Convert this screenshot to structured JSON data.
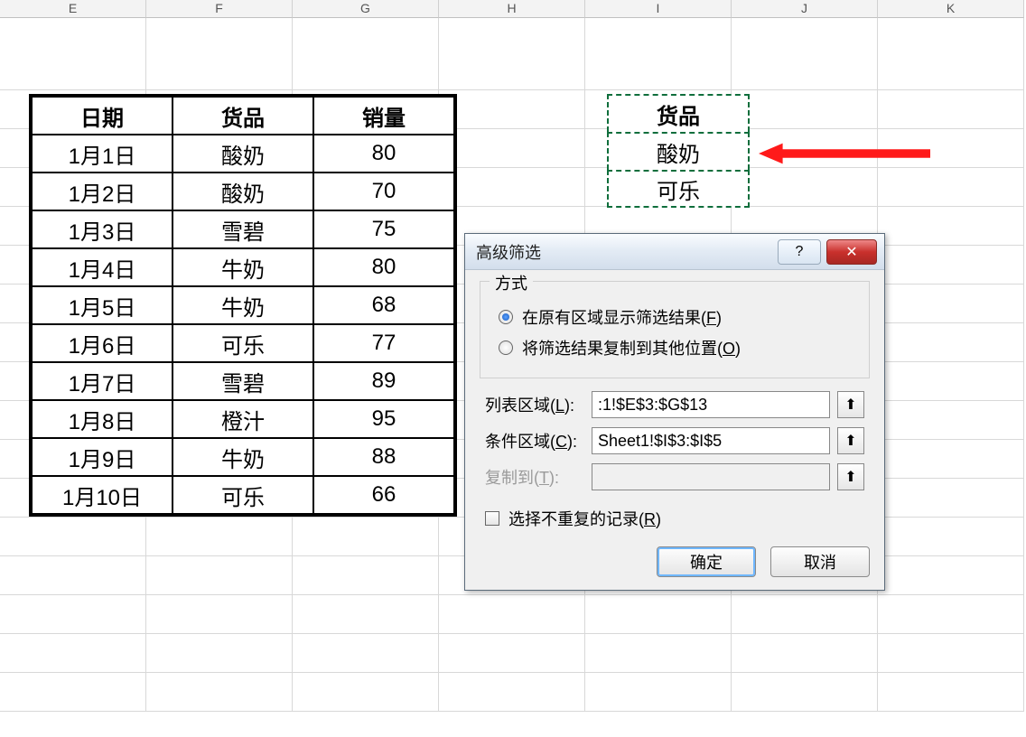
{
  "columns": [
    "E",
    "F",
    "G",
    "H",
    "I",
    "J",
    "K"
  ],
  "data_table": {
    "headers": [
      "日期",
      "货品",
      "销量"
    ],
    "rows": [
      [
        "1月1日",
        "酸奶",
        "80"
      ],
      [
        "1月2日",
        "酸奶",
        "70"
      ],
      [
        "1月3日",
        "雪碧",
        "75"
      ],
      [
        "1月4日",
        "牛奶",
        "80"
      ],
      [
        "1月5日",
        "牛奶",
        "68"
      ],
      [
        "1月6日",
        "可乐",
        "77"
      ],
      [
        "1月7日",
        "雪碧",
        "89"
      ],
      [
        "1月8日",
        "橙汁",
        "95"
      ],
      [
        "1月9日",
        "牛奶",
        "88"
      ],
      [
        "1月10日",
        "可乐",
        "66"
      ]
    ]
  },
  "criteria": {
    "header": "货品",
    "values": [
      "酸奶",
      "可乐"
    ]
  },
  "dialog": {
    "title": "高级筛选",
    "group_label": "方式",
    "radio1_pre": "在原有区域显示筛选结果(",
    "radio1_key": "F",
    "radio1_post": ")",
    "radio2_pre": "将筛选结果复制到其他位置(",
    "radio2_key": "O",
    "radio2_post": ")",
    "label_list_pre": "列表区域(",
    "label_list_key": "L",
    "label_list_post": "):",
    "label_crit_pre": "条件区域(",
    "label_crit_key": "C",
    "label_crit_post": "):",
    "label_copy_pre": "复制到(",
    "label_copy_key": "T",
    "label_copy_post": "):",
    "list_range": ":1!$E$3:$G$13",
    "crit_range": "Sheet1!$I$3:$I$5",
    "copy_range": "",
    "chk_pre": "选择不重复的记录(",
    "chk_key": "R",
    "chk_post": ")",
    "ok": "确定",
    "cancel": "取消",
    "help_glyph": "?",
    "close_glyph": "✕",
    "range_glyph": "⬆"
  }
}
